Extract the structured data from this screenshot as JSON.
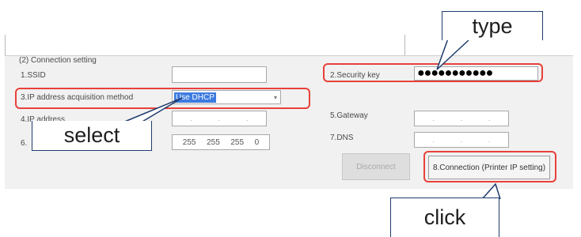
{
  "section_title": "(2) Connection setting",
  "fields": {
    "ssid_label": "1.SSID",
    "ip_method_label": "3.IP address acquisition method",
    "ip_method_value": "Use DHCP",
    "ip_address_label": "4.IP address",
    "subnet_label": "6.",
    "subnet_octets": [
      "255",
      "255",
      "255",
      "0"
    ],
    "security_key_label": "2.Security key",
    "security_key_value": "●●●●●●●●●●●",
    "gateway_label": "5.Gateway",
    "dns_label": "7.DNS",
    "ip_placeholder_dots": "."
  },
  "buttons": {
    "disconnect": "Disconnect",
    "connect": "8.Connection (Printer IP setting)"
  },
  "callouts": {
    "type": "type",
    "select": "select",
    "click": "click"
  },
  "colors": {
    "highlight_red": "#e8413a",
    "callout_border": "#1f3b6e",
    "selection_blue": "#3d7be0"
  }
}
